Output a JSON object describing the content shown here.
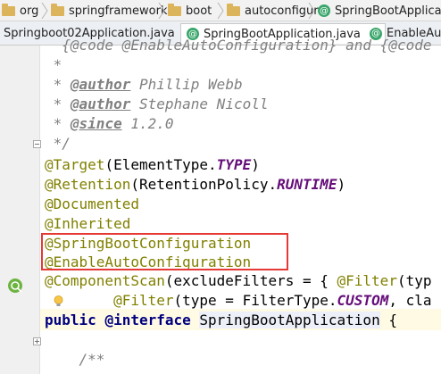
{
  "breadcrumb": {
    "items": [
      "org",
      "springframework",
      "boot",
      "autoconfigure",
      "SpringBootApplicatio"
    ]
  },
  "tabs": [
    {
      "label": "Springboot02Application.java",
      "icon": "class-icon",
      "closable": true
    },
    {
      "label": "SpringBootApplication.java",
      "icon": "annotation-icon",
      "closable": true
    },
    {
      "label": "EnableAuto",
      "icon": "annotation-icon",
      "closable": false
    }
  ],
  "code": {
    "line1_partial": "  {@code @EnableAutoConfiguration} and {@code",
    "star": " *",
    "author_tag": "@author",
    "author1": "Phillip Webb",
    "author2": "Stephane Nicoll",
    "since_tag": "@since",
    "since_value": "1.2.0",
    "comment_end": " */",
    "target_ann": "@Target",
    "target_args_open": "(ElementType.",
    "target_const": "TYPE",
    "close_paren": ")",
    "retention_ann": "@Retention",
    "retention_args_open": "(RetentionPolicy.",
    "retention_const": "RUNTIME",
    "documented": "@Documented",
    "inherited": "@Inherited",
    "sb_config": "@SpringBootConfiguration",
    "enable_auto": "@EnableAutoConfiguration",
    "component_scan": "@ComponentScan",
    "component_scan_args": "(excludeFilters = { ",
    "filter_ann": "@Filter",
    "filter_args1": "(typ",
    "filter_args2": "(type = FilterType.",
    "filter_const": "CUSTOM",
    "filter_tail": ", cla",
    "public_kw": "public",
    "interface_kw": "@interface",
    "class_name": "SpringBootApplication",
    "brace": " {",
    "javadoc_start": "/**"
  },
  "colors": {
    "annotation": "#808000",
    "keyword": "#000080",
    "comment": "#808080",
    "constant": "#660e7a",
    "highlight_box": "#e53935"
  }
}
